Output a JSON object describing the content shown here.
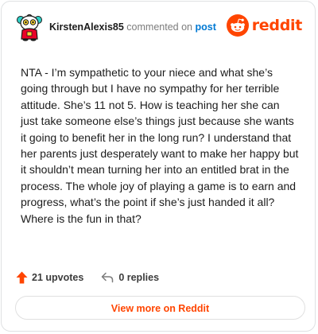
{
  "header": {
    "username": "KirstenAlexis85",
    "action_text": "commented on",
    "post_link": "post",
    "brand_wordmark": "reddit"
  },
  "comment": {
    "body": "NTA - I’m sympathetic to your niece and what she’s going through but I have no sympathy for her terrible attitude. She’s 11 not 5. How is teaching her she can just take someone else’s things just because she wants it going to benefit her in the long run? I understand that her parents just desperately want to make her happy but it shouldn’t mean turning her into an entitled brat in the process. The whole joy of playing a game is to earn and progress, what’s the point if she’s just handed it all? Where is the fun in that?"
  },
  "footer": {
    "upvotes_label": "21 upvotes",
    "replies_label": "0 replies"
  },
  "cta": {
    "label": "View more on Reddit"
  },
  "colors": {
    "brand": "#ff4500",
    "link": "#0079d3",
    "text": "#1c1c1c",
    "muted": "#7c7c7c",
    "border": "#dfe1e3"
  },
  "icons": {
    "avatar": "snoo-avatar-icon",
    "logo": "reddit-logo-icon",
    "upvote": "upvote-arrow-icon",
    "reply": "reply-arrow-icon"
  }
}
